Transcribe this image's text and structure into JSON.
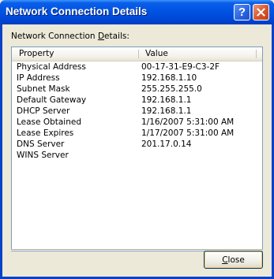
{
  "window": {
    "title": "Network Connection Details",
    "help_glyph": "?",
    "close_glyph": "✕"
  },
  "dialog": {
    "list_label_pre": "Network Connection ",
    "list_label_accel": "D",
    "list_label_post": "etails:",
    "columns": [
      "Property",
      "Value"
    ],
    "rows": [
      {
        "property": "Physical Address",
        "value": "00-17-31-E9-C3-2F"
      },
      {
        "property": "IP Address",
        "value": "192.168.1.10"
      },
      {
        "property": "Subnet Mask",
        "value": "255.255.255.0"
      },
      {
        "property": "Default Gateway",
        "value": "192.168.1.1"
      },
      {
        "property": "DHCP Server",
        "value": "192.168.1.1"
      },
      {
        "property": "Lease Obtained",
        "value": "1/16/2007 5:31:00 AM"
      },
      {
        "property": "Lease Expires",
        "value": "1/17/2007 5:31:00 AM"
      },
      {
        "property": "DNS Server",
        "value": "201.17.0.14"
      },
      {
        "property": "WINS Server",
        "value": ""
      }
    ],
    "close_button_accel": "C",
    "close_button_rest": "lose"
  },
  "colors": {
    "titlebar": "#0054e3",
    "dialog_bg": "#ece9d8",
    "close_red": "#d7552a"
  },
  "icons": [
    "help-icon",
    "close-icon"
  ]
}
